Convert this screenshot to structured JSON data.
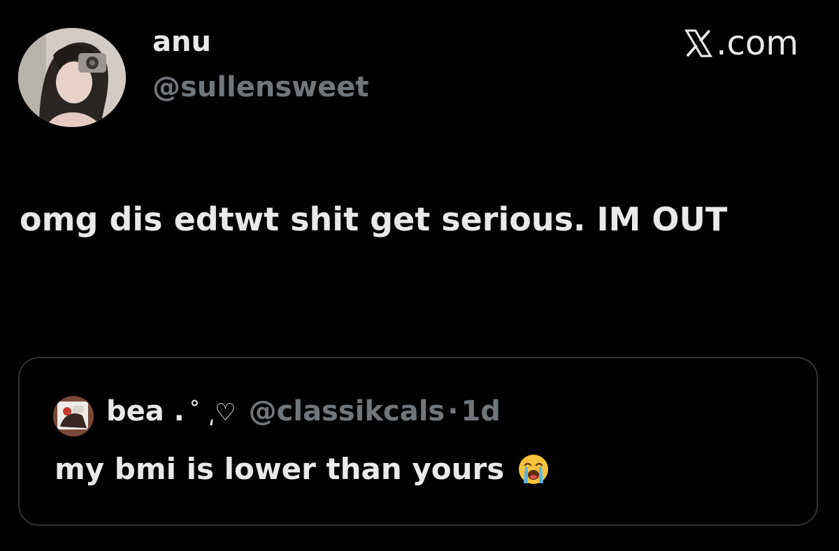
{
  "author": {
    "display_name": "anu",
    "handle": "@sullensweet"
  },
  "brand": {
    "logo_icon": "x-logo-icon",
    "text": ".com"
  },
  "tweet": {
    "text": "omg dis edtwt shit get serious. IM OUT"
  },
  "quoted_tweet": {
    "display_name": "bea .",
    "name_decoration": "˚ ͵♡",
    "handle": "@classikcals",
    "separator": "·",
    "time": "1d",
    "text": "my bmi is lower than yours",
    "emoji": "loudly-crying-face-icon"
  },
  "colors": {
    "background": "#000000",
    "primary_text": "#e7e9ea",
    "secondary_text": "#71767b",
    "border": "#2f3336"
  }
}
